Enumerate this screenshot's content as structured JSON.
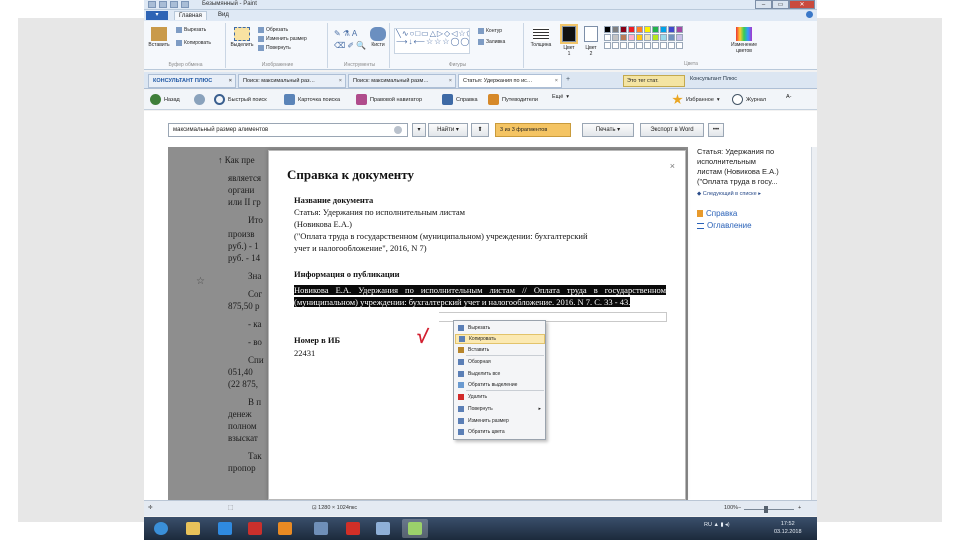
{
  "paint": {
    "title": "Безымянный - Paint",
    "tabs": [
      "Главная",
      "Вид"
    ],
    "file_button": "▾",
    "clipboard": {
      "paste": "Вставить",
      "cut": "Вырезать",
      "copy": "Копировать",
      "label": "Буфер обмена"
    },
    "image": {
      "select": "Выделить",
      "crop": "Обрезать",
      "resize": "Изменить размер",
      "rotate": "Повернуть",
      "label": "Изображение"
    },
    "tools": {
      "brushes": "Кисти",
      "label": "Инструменты"
    },
    "shapes": {
      "label": "Фигуры",
      "outline": "Контур",
      "fill": "Заливка",
      "glyphs": "╲∿○□▭△▷◇◁☆⬠⬡ ⟶↓⟵☆☆☆◯◯"
    },
    "thickness": "Толщина",
    "color1": {
      "line1": "Цвет",
      "line2": "1"
    },
    "color2": {
      "line1": "Цвет",
      "line2": "2"
    },
    "colors_label": "Цвета",
    "edit_colors": "Изменение цветов",
    "palette": [
      "#000000",
      "#7f7f7f",
      "#880015",
      "#ed1c24",
      "#ff7f27",
      "#fff200",
      "#22b14c",
      "#00a2e8",
      "#3f48cc",
      "#a349a4",
      "#ffffff",
      "#c3c3c3",
      "#b97a57",
      "#ffaec9",
      "#ffc90e",
      "#efe4b0",
      "#b5e61d",
      "#99d9ea",
      "#7092be",
      "#c8bfe7",
      "#ffffff",
      "#ffffff",
      "#ffffff",
      "#ffffff",
      "#ffffff",
      "#ffffff",
      "#ffffff",
      "#ffffff",
      "#ffffff",
      "#ffffff"
    ]
  },
  "browser": {
    "tabs": [
      {
        "label": "КОНСУЛЬТАНТ ПЛЮС",
        "variant": "first"
      },
      {
        "label": "Поиск: максимальный раз…",
        "variant": "normal"
      },
      {
        "label": "Поиск: максимальный разм…",
        "variant": "normal"
      },
      {
        "label": "Статья: Удержания по ис…",
        "variant": "active"
      }
    ],
    "zoom_badge": "Это тег стат.",
    "tab_right": "Консультант Плюс",
    "toolbar": {
      "back": "Назад",
      "quick_search": "Быстрый поиск",
      "card_search": "Карточка поиска",
      "legal_navigator": "Правовой навигатор",
      "reference": "Справка",
      "codecs": "Путеводители",
      "more": "Ещё",
      "favorites": "Избранное",
      "journal": "Журнал",
      "font": "A-"
    },
    "search": {
      "value": "максимальный размер алиментов",
      "find_button": "Найти",
      "found": "3 из 3 фрагментов",
      "print": "Печать",
      "export_word": "Экспорт в Word",
      "more": "•••"
    },
    "right_panel": {
      "title_lines": [
        "Статья: Удержания по",
        "исполнительным",
        "листам (Новикова Е.А.)",
        "(\"Оплата труда в госу..."
      ],
      "nav": "Следующий в списке",
      "link_reference": "Справка",
      "link_contents": "Оглавление"
    },
    "doc_bg_lines": [
      "↑ Как пре",
      "является",
      "органи",
      "или II гр",
      "Ито",
      "произв",
      "руб.) - 1",
      "руб. - 14",
      "Зна",
      "Сог",
      "875,50 р",
      "- ка",
      "- во",
      "Спи",
      "051,40",
      "(22 875,",
      "В п",
      "денеж",
      "полном",
      "взыскат",
      "Так",
      "пропор"
    ]
  },
  "modal": {
    "title": "Справка к документу",
    "close": "×",
    "name_label": "Название документа",
    "name_lines": [
      "Статья: Удержания по исполнительным листам",
      "(Новикова Е.А.)",
      "(\"Оплата труда в государственном (муниципальном) учреждении: бухгалтерский",
      "учет и налогообложение\", 2016, N 7)"
    ],
    "pub_label": "Информация о публикации",
    "pub_text": "Новикова Е.А. Удержания по исполнительным листам // Оплата труда в государственном (муниципальном) учреждении: бухгалтерский учет и налогообложение. 2016. N 7. С. 33 - 43.",
    "ib_label": "Номер в ИБ",
    "ib_number": "22431",
    "checkmark": "√"
  },
  "context_menu": {
    "items": [
      {
        "label": "Вырезать",
        "icon_color": "#5b7fb6",
        "hover": false
      },
      {
        "label": "Копировать",
        "icon_color": "#5b7fb6",
        "hover": true
      },
      {
        "label": "Вставить",
        "icon_color": "#b8862c",
        "hover": false
      },
      {
        "label": "Обзорная",
        "icon_color": "#5b7fb6",
        "hover": false
      },
      {
        "label": "Выделить все",
        "icon_color": "#5b7fb6",
        "hover": false
      },
      {
        "label": "Обратить выделение",
        "icon_color": "#6a9ad0",
        "hover": false
      },
      {
        "label": "Удалить",
        "icon_color": "#d12a2a",
        "hover": false
      },
      {
        "label": "Повернуть",
        "icon_color": "#5b7fb6",
        "hover": false,
        "submenu": "▸"
      },
      {
        "label": "Изменить размер",
        "icon_color": "#5b7fb6",
        "hover": false
      },
      {
        "label": "Обратить цвета",
        "icon_color": "#5b7fb6",
        "hover": false
      }
    ]
  },
  "status": {
    "canvas_size": "1280 × 1024пкс",
    "zoom": "100%",
    "minus": "−",
    "plus": "+"
  },
  "taskbar": {
    "apps": [
      {
        "name": "start",
        "color": "#3a8fd8"
      },
      {
        "name": "explorer",
        "color": "#e8c25a"
      },
      {
        "name": "ie",
        "color": "#2f8ae0"
      },
      {
        "name": "app-red",
        "color": "#c9302c"
      },
      {
        "name": "media",
        "color": "#e98a23"
      },
      {
        "name": "consultant",
        "color": "#6f8fb8"
      },
      {
        "name": "pdf",
        "color": "#d22f27"
      },
      {
        "name": "paint-user",
        "color": "#8fb0d8"
      },
      {
        "name": "paint",
        "color": "#9bd16b"
      }
    ],
    "tray": "RU  ▲  ▮  ◂)",
    "time": "17:52",
    "date": "03.12.2018"
  }
}
